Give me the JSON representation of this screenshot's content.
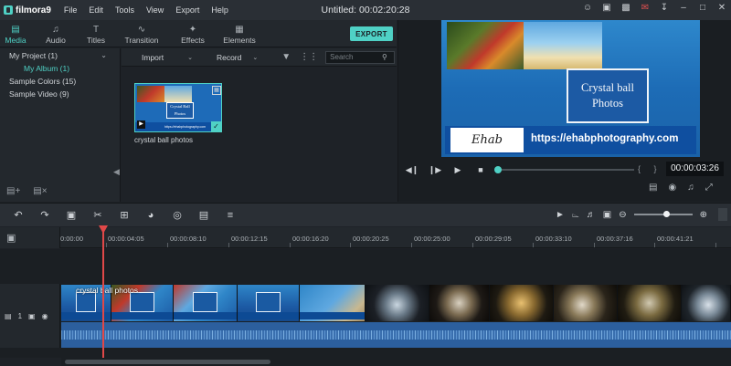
{
  "app": {
    "logo_text": "filmora9",
    "window_title": "Untitled:  00:02:20:28",
    "menu": [
      "File",
      "Edit",
      "Tools",
      "View",
      "Export",
      "Help"
    ],
    "window_controls": [
      "user-icon",
      "cart-icon",
      "gift-icon",
      "mail-icon",
      "download-icon",
      "minimize-icon",
      "maximize-icon",
      "close-icon"
    ]
  },
  "tabs": [
    {
      "label": "Media",
      "icon": "folder-icon",
      "active": true
    },
    {
      "label": "Audio",
      "icon": "music-note-icon",
      "active": false
    },
    {
      "label": "Titles",
      "icon": "text-icon",
      "active": false
    },
    {
      "label": "Transition",
      "icon": "transition-icon",
      "active": false
    },
    {
      "label": "Effects",
      "icon": "effects-icon",
      "active": false
    },
    {
      "label": "Elements",
      "icon": "image-icon",
      "active": false
    }
  ],
  "export_label": "EXPORT",
  "library": {
    "project": "My Project (1)",
    "album": "My Album (1)",
    "sample_colors": "Sample Colors (15)",
    "sample_video": "Sample Video (9)"
  },
  "media_toolbar": {
    "import_label": "Import",
    "record_label": "Record",
    "search_placeholder": "Search"
  },
  "media_items": [
    {
      "label": "crystal ball photos",
      "thumb_title": "Crystal Ball Photos",
      "thumb_url": "https://ehabphotography.com"
    }
  ],
  "preview": {
    "title_line1": "Crystal ball",
    "title_line2": "Photos",
    "signature": "Ehab",
    "url": "https://ehabphotography.com",
    "timecode": "00:00:03:26",
    "playback_progress": 0.0,
    "marks": "{ }"
  },
  "timeline": {
    "zoom_level": 0.55,
    "ruler_labels": [
      "0:00:00",
      "00:00:04:05",
      "00:00:08:10",
      "00:00:12:15",
      "00:00:16:20",
      "00:00:20:25",
      "00:00:25:00",
      "00:00:29:05",
      "00:00:33:10",
      "00:00:37:16",
      "00:00:41:21"
    ],
    "clip_label": "crystal ball photos",
    "track_number": "1",
    "playhead_time": "00:00:03:26"
  },
  "colors": {
    "accent": "#4fd1c5",
    "playhead": "#e04848",
    "title_blue": "#1c5aa4"
  }
}
